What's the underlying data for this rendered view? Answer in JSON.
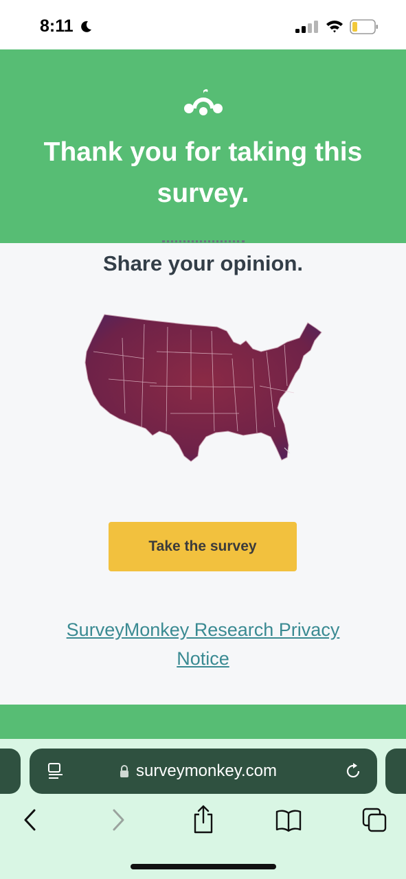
{
  "status_bar": {
    "time": "8:11",
    "icons": [
      "moon-icon",
      "signal-icon",
      "wifi-icon",
      "battery-icon"
    ]
  },
  "banner": {
    "logo_icon": "surveymonkey-logo-icon",
    "title": "Thank you for taking this survey."
  },
  "main": {
    "heading": "Share your opinion.",
    "map_icon": "us-map-image",
    "button_label": "Take the survey",
    "privacy_link": "SurveyMonkey Research Privacy Notice"
  },
  "browser": {
    "url": "surveymonkey.com",
    "icons": [
      "reader-icon",
      "lock-icon",
      "reload-icon",
      "back-icon",
      "forward-icon",
      "share-icon",
      "bookmarks-icon",
      "tabs-icon"
    ]
  },
  "colors": {
    "brand_green": "#57bd74",
    "button_yellow": "#f2c13e",
    "link_teal": "#3a8a92",
    "map_fill": "#7a2447",
    "browser_pill": "#2f5140",
    "browser_bg": "#d9f6e4"
  }
}
